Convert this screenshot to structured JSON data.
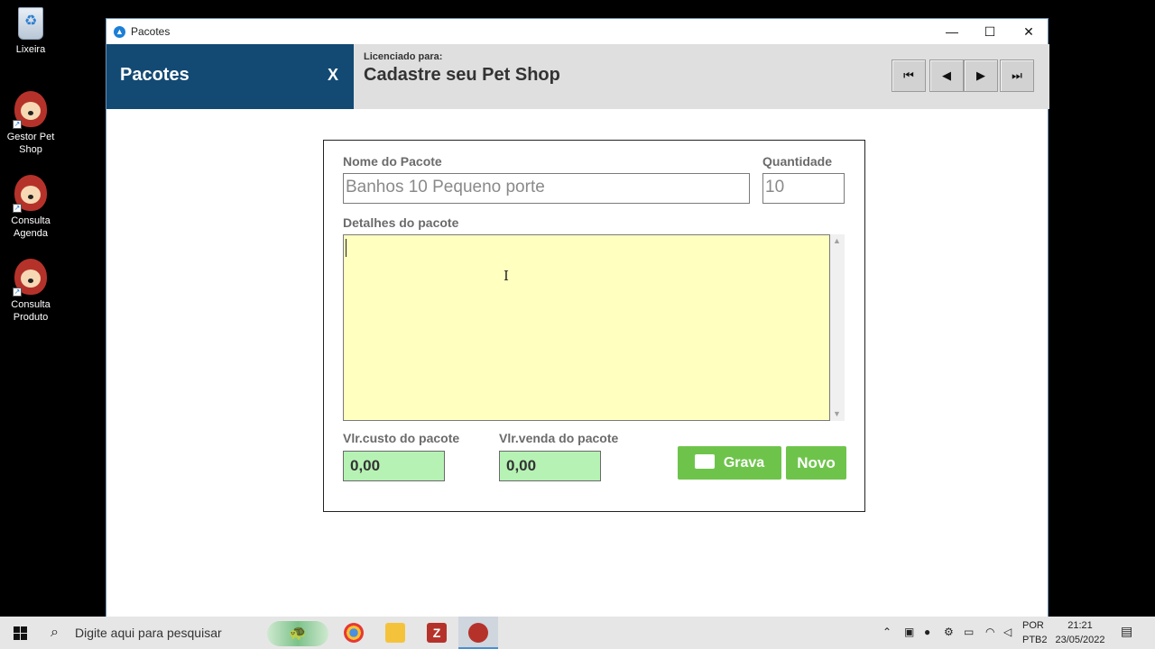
{
  "desktop": {
    "icons": [
      {
        "label": "Lixeira"
      },
      {
        "label": "Gestor Pet Shop"
      },
      {
        "label": "Consulta Agenda"
      },
      {
        "label": "Consulta Produto"
      }
    ]
  },
  "window": {
    "title": "Pacotes",
    "controls": {
      "minimize": "—",
      "maximize": "☐",
      "close": "✕"
    }
  },
  "header": {
    "title": "Pacotes",
    "close_label": "X",
    "license_label": "Licenciado para:",
    "license_name": "Cadastre seu Pet Shop",
    "nav": {
      "first": "⏮",
      "prev": "◀",
      "next": "▶",
      "last": "⏭"
    }
  },
  "form": {
    "package_name_label": "Nome do Pacote",
    "package_name_value": "Banhos 10 Pequeno porte",
    "quantity_label": "Quantidade",
    "quantity_value": "10",
    "details_label": "Detalhes do pacote",
    "details_value": "",
    "cost_label": "Vlr.custo do pacote",
    "cost_value": "0,00",
    "sale_label": "Vlr.venda do pacote",
    "sale_value": "0,00",
    "save_label": "Grava",
    "new_label": "Novo"
  },
  "taskbar": {
    "search_placeholder": "Digite aqui para pesquisar",
    "lang_line1": "POR",
    "lang_line2": "PTB2",
    "time": "21:21",
    "date": "23/05/2022"
  },
  "colors": {
    "header_dark": "#134a74",
    "header_light": "#dfdfdf",
    "details_bg": "#ffffc0",
    "money_bg": "#b6f2b4",
    "button_green": "#6ec44b"
  }
}
